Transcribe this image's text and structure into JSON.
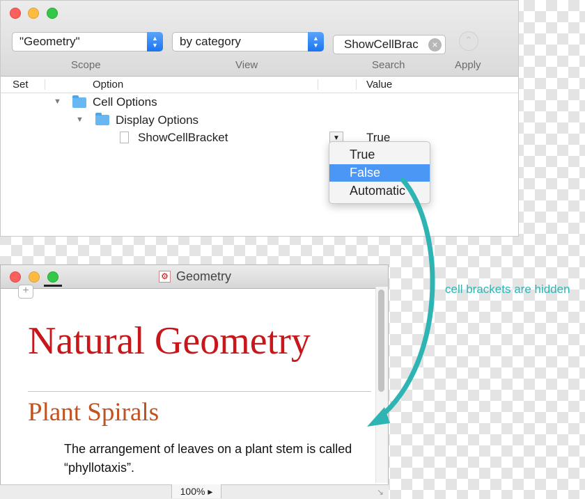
{
  "inspector": {
    "scope_value": "\"Geometry\"",
    "view_value": "by category",
    "search_value": "ShowCellBrac",
    "labels": {
      "scope": "Scope",
      "view": "View",
      "search": "Search",
      "apply": "Apply"
    },
    "columns": {
      "set": "Set",
      "option": "Option",
      "value": "Value"
    },
    "tree": [
      {
        "label": "Cell Options",
        "icon": "folder-icon",
        "expanded": true
      },
      {
        "label": "Display Options",
        "icon": "folder-icon",
        "expanded": true
      },
      {
        "label": "ShowCellBracket",
        "icon": "document-icon",
        "value": "True"
      }
    ],
    "menu": {
      "items": [
        "True",
        "False",
        "Automatic"
      ],
      "selected": "False"
    }
  },
  "notebook": {
    "window_title": "Geometry",
    "title": "Natural Geometry",
    "section": "Plant Spirals",
    "text": "The arrangement of leaves on a plant stem is called “phyllotaxis”.",
    "zoom": "100%"
  },
  "annotation": {
    "text": "cell brackets are hidden",
    "color": "#2fb4b4"
  },
  "colors": {
    "title_red": "#c8171a",
    "section_orange": "#c0531f",
    "selection_blue": "#4b97f6"
  }
}
